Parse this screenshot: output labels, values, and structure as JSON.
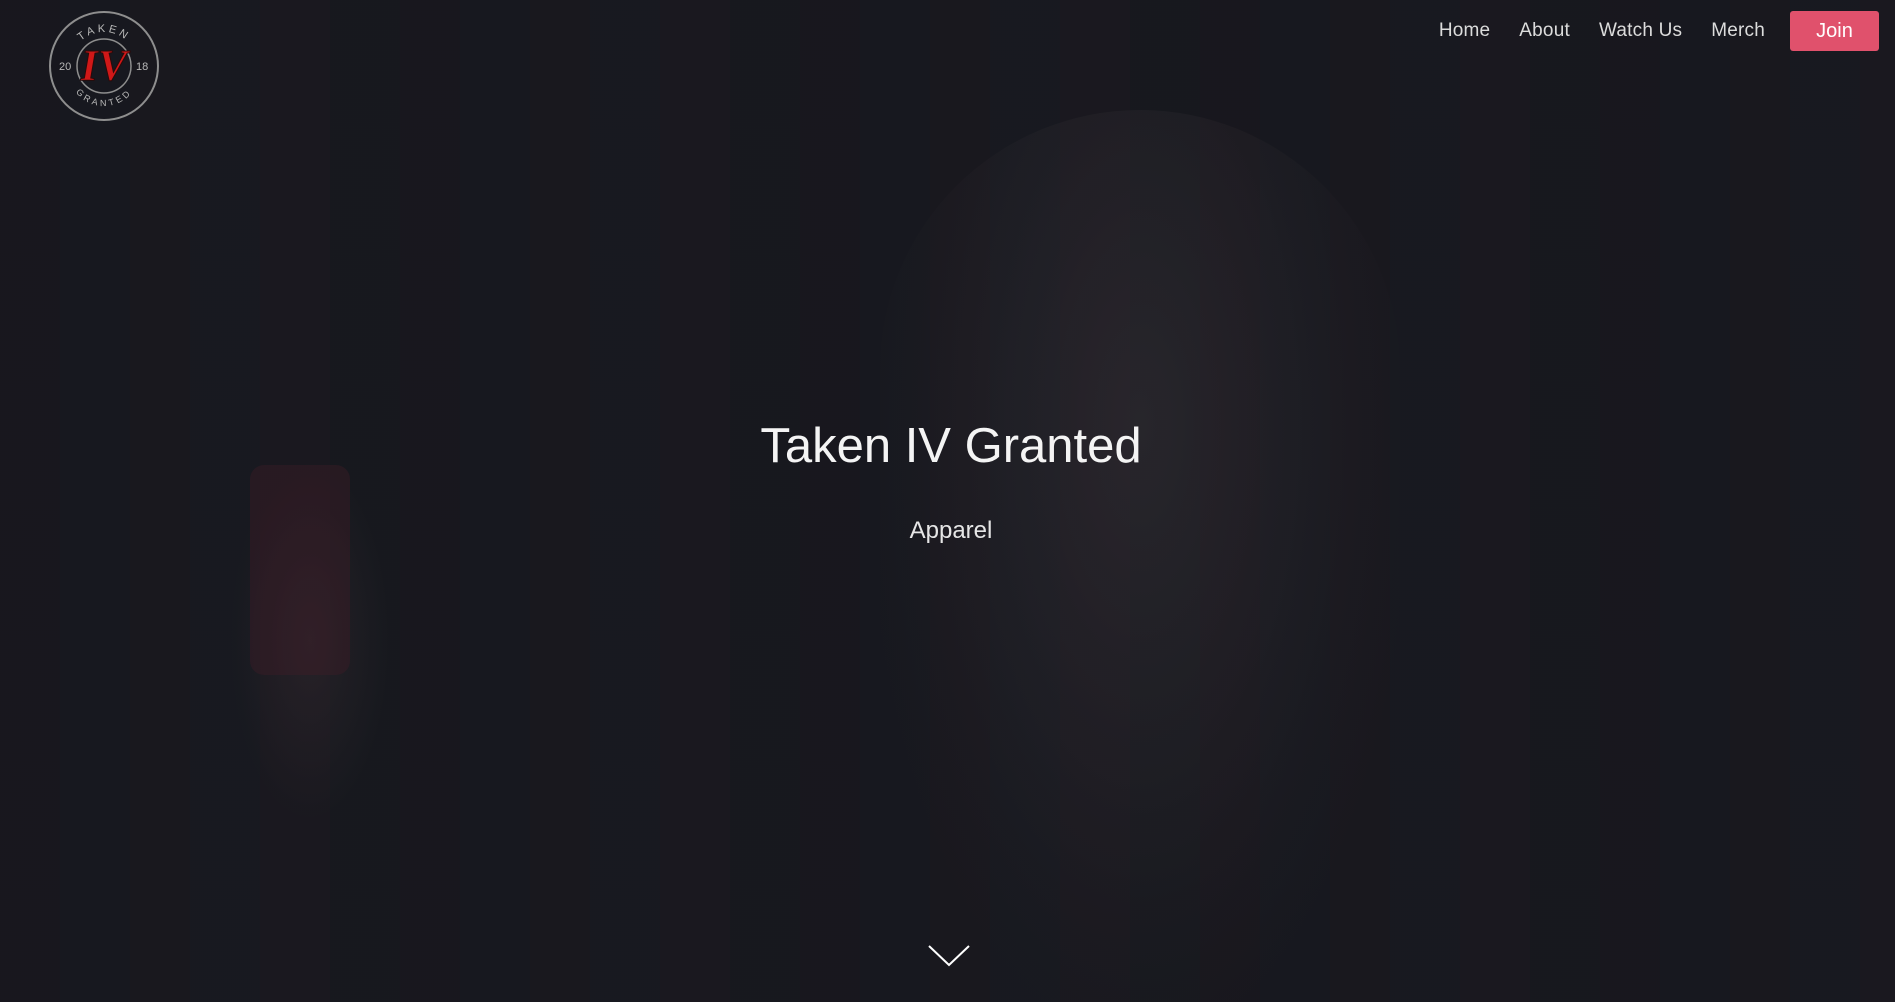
{
  "brand": {
    "logo_top": "TAKEN",
    "logo_bottom": "GRANTED",
    "logo_mark": "IV",
    "logo_year_left": "20",
    "logo_year_right": "18",
    "accent_color": "#e0516c"
  },
  "nav": {
    "items": [
      {
        "label": "Home"
      },
      {
        "label": "About"
      },
      {
        "label": "Watch Us"
      },
      {
        "label": "Merch"
      }
    ],
    "join_label": "Join"
  },
  "hero": {
    "title": "Taken IV Granted",
    "subtitle": "Apparel",
    "scroll_icon": "chevron-down-icon"
  }
}
